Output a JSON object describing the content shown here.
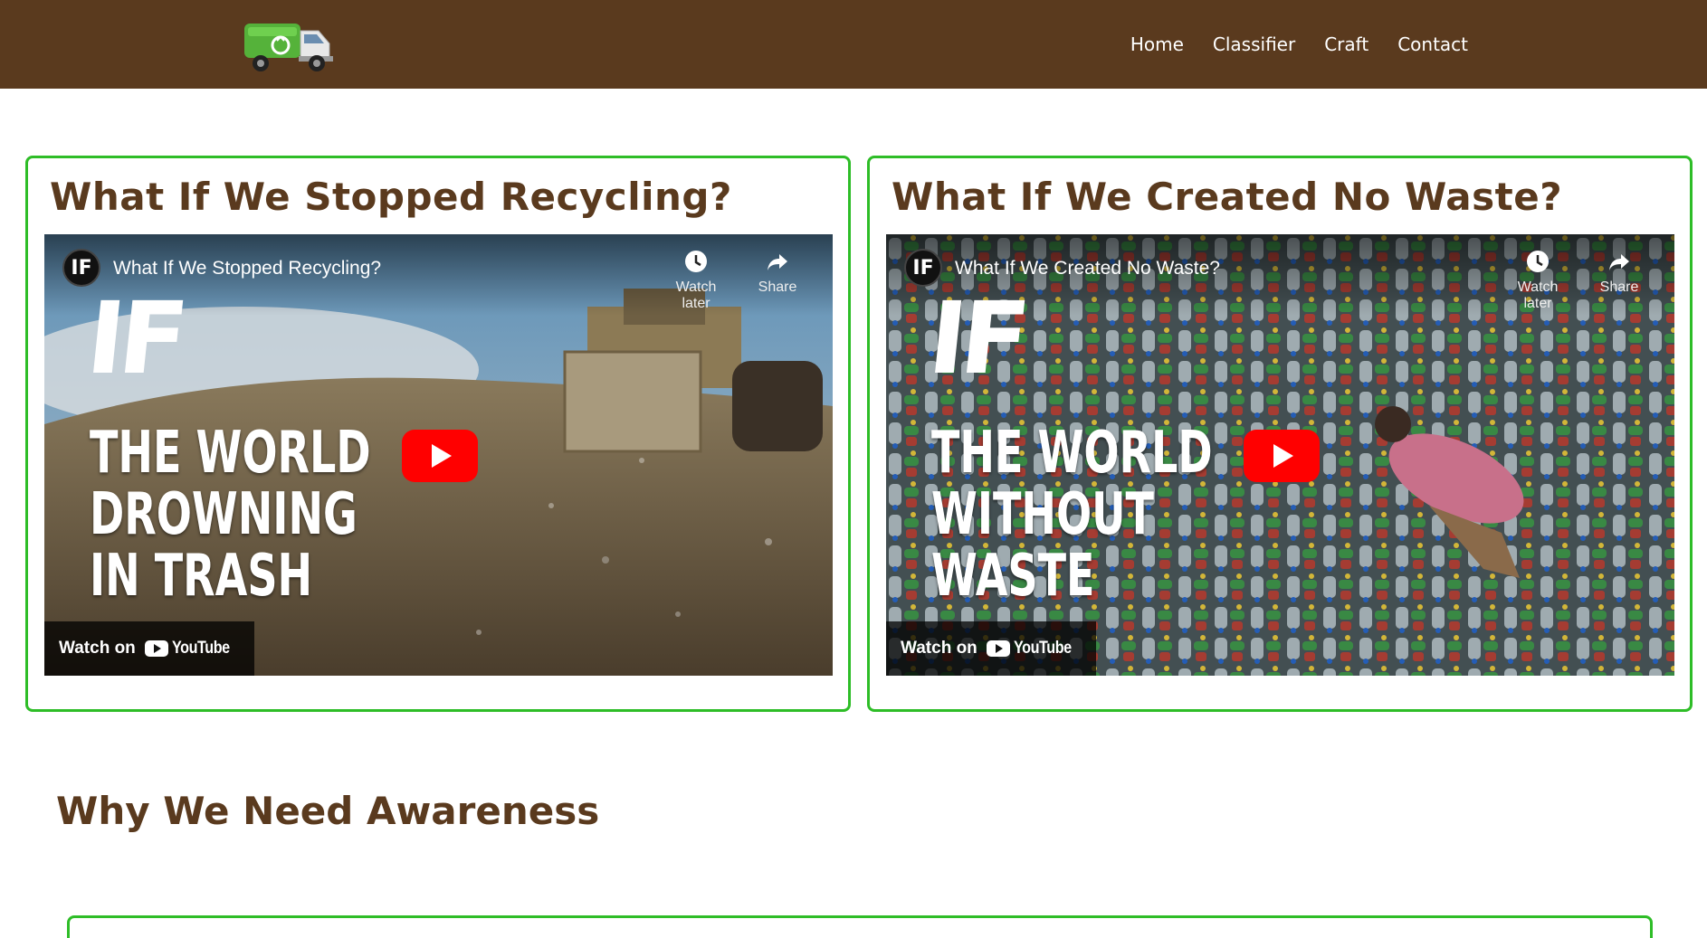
{
  "nav": {
    "links": [
      "Home",
      "Classifier",
      "Craft",
      "Contact"
    ]
  },
  "videos": [
    {
      "card_title": "What If We Stopped Recycling?",
      "video_title": "What If We Stopped Recycling?",
      "thumb_lines": [
        "THE WORLD",
        "DROWNING",
        "IN TRASH"
      ],
      "watch_later": "Watch later",
      "share": "Share",
      "watch_on": "Watch on",
      "youtube": "YouTube",
      "channel": "IF"
    },
    {
      "card_title": "What If We Created No Waste?",
      "video_title": "What If We Created No Waste?",
      "thumb_lines": [
        "THE WORLD",
        "WITHOUT",
        "WASTE"
      ],
      "watch_later": "Watch later",
      "share": "Share",
      "watch_on": "Watch on",
      "youtube": "YouTube",
      "channel": "IF"
    }
  ],
  "section": {
    "title": "Why We Need Awareness"
  },
  "colors": {
    "header": "#5a3a1e",
    "accent_border": "#2ebd27",
    "heading": "#5a3a1e",
    "play": "#ff0000"
  },
  "icons": {
    "logo": "garbage-truck-icon",
    "watch_later": "clock-icon",
    "share": "share-arrow-icon",
    "play": "play-icon"
  }
}
